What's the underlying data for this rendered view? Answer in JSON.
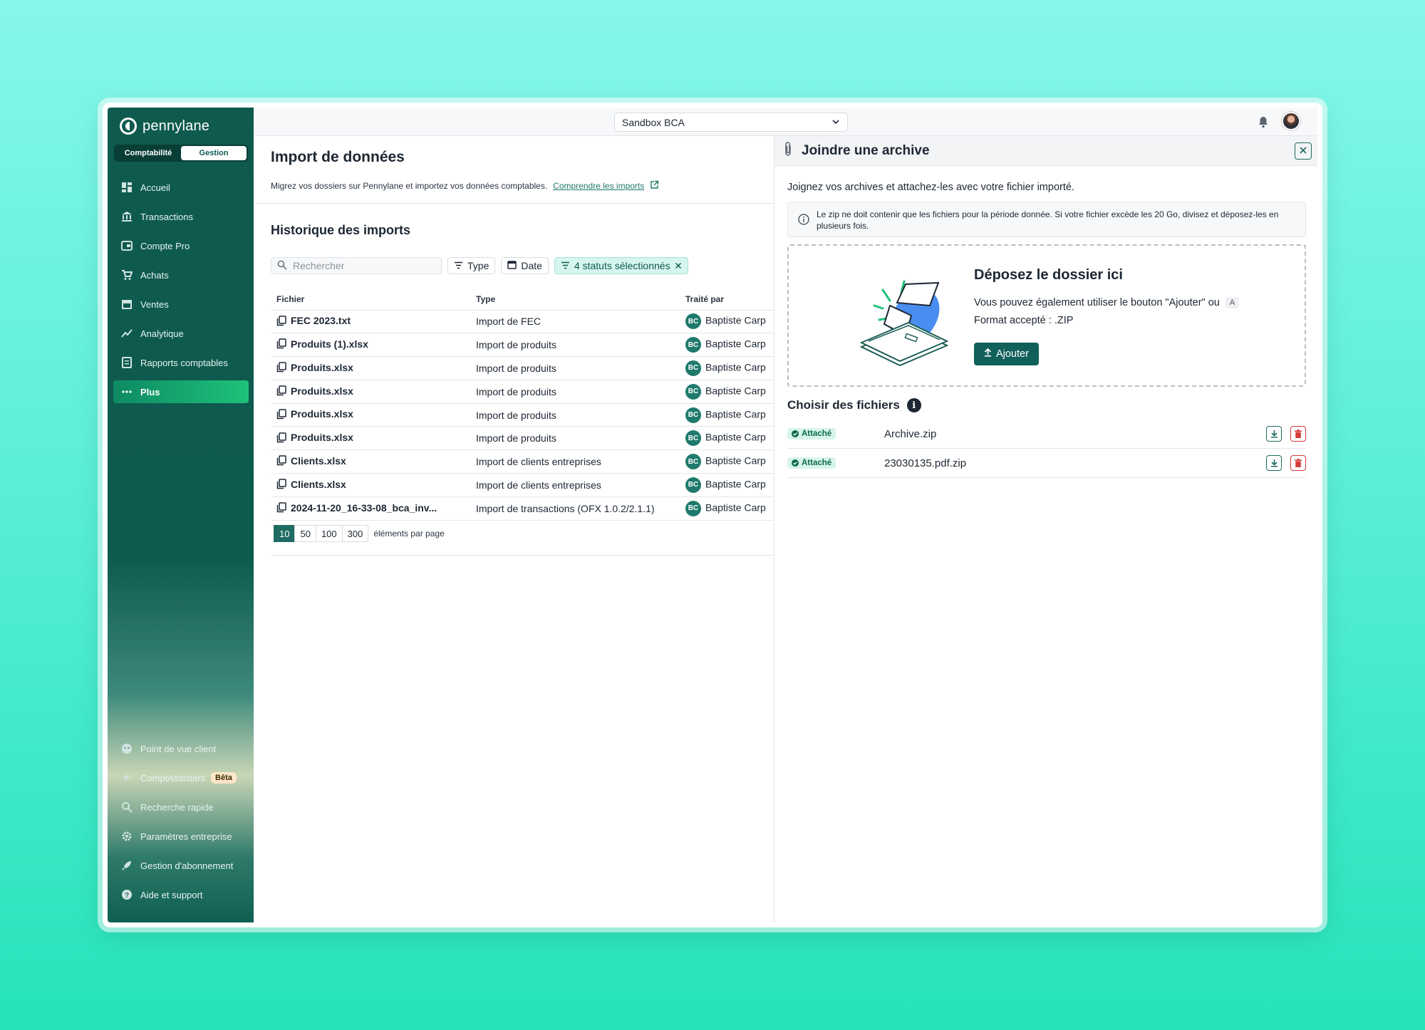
{
  "sidebar": {
    "brand": "pennylane",
    "toggle": [
      "Comptabilité",
      "Gestion"
    ],
    "items": [
      {
        "label": "Accueil",
        "icon": "dashboard-icon"
      },
      {
        "label": "Transactions",
        "icon": "bank-icon"
      },
      {
        "label": "Compte Pro",
        "icon": "wallet-icon"
      },
      {
        "label": "Achats",
        "icon": "cart-icon"
      },
      {
        "label": "Ventes",
        "icon": "store-icon"
      },
      {
        "label": "Analytique",
        "icon": "chart-line-icon"
      },
      {
        "label": "Rapports comptables",
        "icon": "report-icon"
      },
      {
        "label": "Plus",
        "icon": "more-dots-icon"
      }
    ],
    "bottom_items": [
      {
        "label": "Point de vue client",
        "icon": "face-icon"
      },
      {
        "label": "ComptAssistant",
        "icon": "sparkle-icon",
        "badge": "Bêta"
      },
      {
        "label": "Recherche rapide",
        "icon": "search-icon"
      },
      {
        "label": "Paramètres entreprise",
        "icon": "gear-icon"
      },
      {
        "label": "Gestion d'abonnement",
        "icon": "rocket-icon"
      },
      {
        "label": "Aide et support",
        "icon": "help-icon"
      }
    ]
  },
  "topbar": {
    "company": "Sandbox BCA"
  },
  "main": {
    "title": "Import de données",
    "description": "Migrez vos dossiers sur Pennylane et importez vos données comptables.",
    "link": "Comprendre les imports",
    "history_title": "Historique des imports",
    "search_placeholder": "Rechercher",
    "filters": {
      "type": "Type",
      "date": "Date",
      "status": "4 statuts sélectionnés"
    },
    "columns": [
      "Fichier",
      "Type",
      "Traité par"
    ],
    "rows": [
      {
        "file": "FEC 2023.txt",
        "type": "Import de FEC",
        "initials": "BC",
        "by": "Baptiste Carp"
      },
      {
        "file": "Produits (1).xlsx",
        "type": "Import de produits",
        "initials": "BC",
        "by": "Baptiste Carp"
      },
      {
        "file": "Produits.xlsx",
        "type": "Import de produits",
        "initials": "BC",
        "by": "Baptiste Carp"
      },
      {
        "file": "Produits.xlsx",
        "type": "Import de produits",
        "initials": "BC",
        "by": "Baptiste Carp"
      },
      {
        "file": "Produits.xlsx",
        "type": "Import de produits",
        "initials": "BC",
        "by": "Baptiste Carp"
      },
      {
        "file": "Produits.xlsx",
        "type": "Import de produits",
        "initials": "BC",
        "by": "Baptiste Carp"
      },
      {
        "file": "Clients.xlsx",
        "type": "Import de clients entreprises",
        "initials": "BC",
        "by": "Baptiste Carp"
      },
      {
        "file": "Clients.xlsx",
        "type": "Import de clients entreprises",
        "initials": "BC",
        "by": "Baptiste Carp"
      },
      {
        "file": "2024-11-20_16-33-08_bca_inv...",
        "type": "Import de transactions (OFX 1.0.2/2.1.1)",
        "initials": "BC",
        "by": "Baptiste Carp"
      }
    ],
    "pager": {
      "sizes": [
        "10",
        "50",
        "100",
        "300"
      ],
      "label": "éléments par page"
    }
  },
  "panel": {
    "title": "Joindre une archive",
    "description": "Joignez vos archives et attachez-les avec votre fichier importé.",
    "info": "Le zip ne doit contenir que les fichiers pour la période donnée. Si votre fichier excède les 20 Go, divisez et déposez-les en plusieurs fois.",
    "dropzone": {
      "title": "Déposez le dossier ici",
      "line1": "Vous pouvez également utiliser le bouton \"Ajouter\" ou",
      "shortcut": "A",
      "line2": "Format accepté : .ZIP",
      "button": "Ajouter"
    },
    "files_title": "Choisir des fichiers",
    "files": [
      {
        "status": "Attaché",
        "name": "Archive.zip"
      },
      {
        "status": "Attaché",
        "name": "23030135.pdf.zip"
      }
    ]
  },
  "colors": {
    "brand_dark": "#0f5a4f",
    "accent": "#1ec27a",
    "danger": "#d63a3a"
  }
}
